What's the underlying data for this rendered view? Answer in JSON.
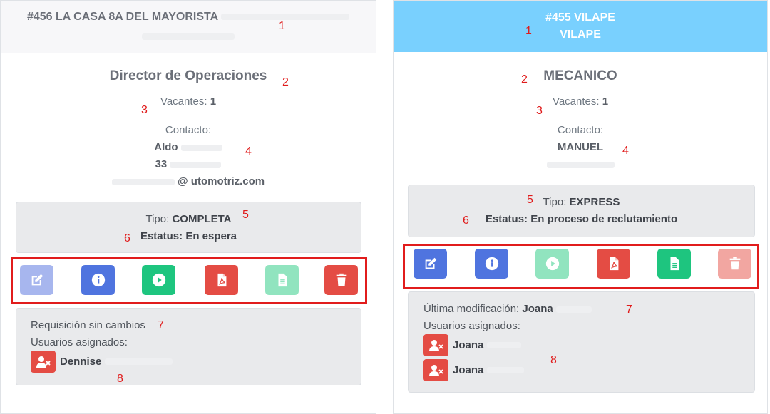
{
  "colors": {
    "header_blue": "#79d0fe",
    "btn_blue": "#4f74df",
    "btn_blue_disabled": "#a7b6ee",
    "btn_green": "#1ec57f",
    "btn_green_disabled": "#91e4bf",
    "btn_red": "#e44c44",
    "btn_red_disabled": "#f2a6a1",
    "annotation_red": "#e01b1b"
  },
  "cards": [
    {
      "header": {
        "line1": "#456 LA CASA 8A DEL MAYORISTA"
      },
      "position_title": "Director de Operaciones",
      "vacancies_label": "Vacantes:",
      "vacancies_value": "1",
      "contact_label": "Contacto:",
      "contact_name": "Aldo",
      "contact_phone": "33",
      "contact_email": "@        utomotriz.com",
      "tipo_label": "Tipo:",
      "tipo_value": "COMPLETA",
      "estatus_label": "Estatus:",
      "estatus_value": "En espera",
      "actions": [
        {
          "icon": "edit-icon",
          "color": "blue-disabled"
        },
        {
          "icon": "info-icon",
          "color": "blue"
        },
        {
          "icon": "play-icon",
          "color": "green"
        },
        {
          "icon": "pdf-icon",
          "color": "red"
        },
        {
          "icon": "file-icon",
          "color": "green-disabled"
        },
        {
          "icon": "trash-icon",
          "color": "red"
        }
      ],
      "footer_line1": "Requisición sin cambios",
      "assigned_label": "Usuarios asignados:",
      "users": [
        "Dennise"
      ],
      "annotations": [
        "1",
        "2",
        "3",
        "4",
        "5",
        "6",
        "7",
        "8"
      ]
    },
    {
      "header": {
        "line1": "#455 VILAPE",
        "line2": "VILAPE"
      },
      "position_title": "MECANICO",
      "vacancies_label": "Vacantes:",
      "vacancies_value": "1",
      "contact_label": "Contacto:",
      "contact_name": "MANUEL",
      "tipo_label": "Tipo:",
      "tipo_value": "EXPRESS",
      "estatus_label": "Estatus:",
      "estatus_value": "En proceso de reclutamiento",
      "actions": [
        {
          "icon": "edit-icon",
          "color": "blue"
        },
        {
          "icon": "info-icon",
          "color": "blue"
        },
        {
          "icon": "play-icon",
          "color": "green-disabled"
        },
        {
          "icon": "pdf-icon",
          "color": "red"
        },
        {
          "icon": "file-icon",
          "color": "green"
        },
        {
          "icon": "trash-icon",
          "color": "red-disabled"
        }
      ],
      "last_mod_label": "Última modificación:",
      "last_mod_user": "Joana",
      "assigned_label": "Usuarios asignados:",
      "users": [
        "Joana",
        "Joana"
      ],
      "annotations": [
        "1",
        "2",
        "3",
        "4",
        "5",
        "6",
        "7",
        "8"
      ]
    }
  ]
}
